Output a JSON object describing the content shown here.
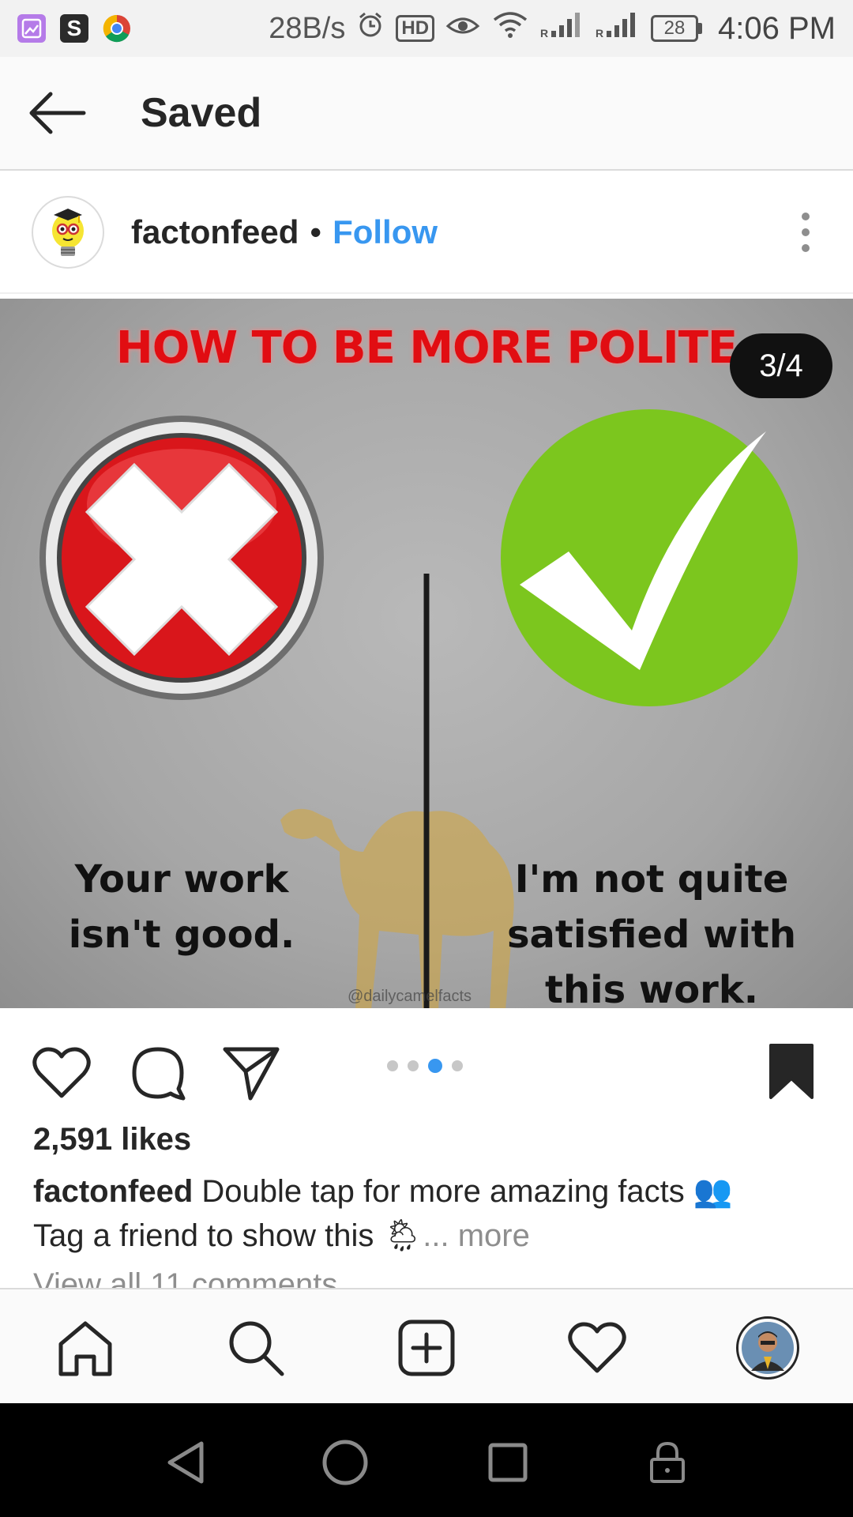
{
  "status_bar": {
    "net_speed": "28B/s",
    "hd_badge": "HD",
    "battery": "28",
    "time": "4:06 PM",
    "icons": [
      "gallery-app-icon",
      "s-app-icon",
      "chrome-icon",
      "alarm-icon",
      "eye-icon",
      "wifi-icon",
      "signal-icon",
      "signal-icon"
    ]
  },
  "header": {
    "title": "Saved",
    "back_icon": "arrow-left-icon"
  },
  "post": {
    "username": "factonfeed",
    "separator": "•",
    "follow_label": "Follow",
    "image": {
      "title": "HOW TO BE MORE POLITE",
      "counter": "3/4",
      "left_caption": "Your work isn't good.",
      "right_caption": "I'm not quite satisfied with this work.",
      "watermark": "@dailycamelfacts",
      "colors": {
        "title": "#e10d12",
        "cross": "#d9161b",
        "check": "#7cc61e"
      }
    },
    "carousel": {
      "total": 4,
      "active_index": 2
    },
    "likes": "2,591 likes",
    "caption_user": "factonfeed",
    "caption_line1": "Double tap for more amazing facts",
    "caption_emoji1": "👥",
    "caption_line2": "Tag a friend to show this",
    "caption_emoji2": "🌦",
    "caption_more": "... more",
    "comments_link": "View all 11 comments"
  },
  "bottom_nav": [
    "home-icon",
    "search-icon",
    "add-post-icon",
    "activity-heart-icon",
    "profile-avatar"
  ],
  "accent_color": "#3897f0"
}
